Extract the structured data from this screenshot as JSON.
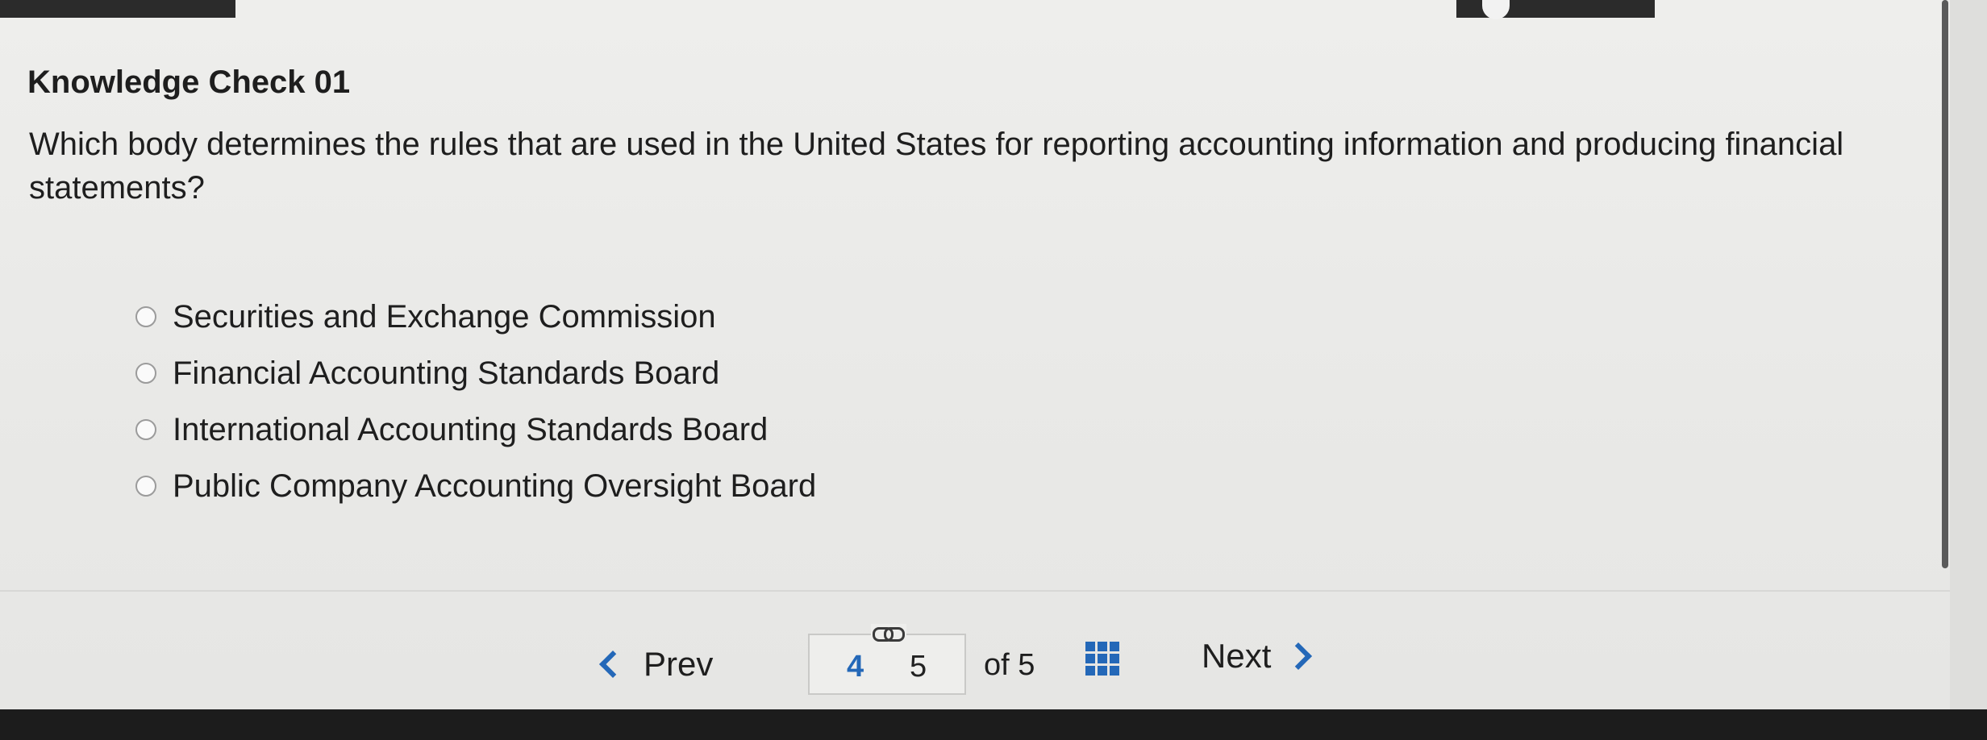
{
  "quiz": {
    "title": "Knowledge Check 01",
    "question": "Which body determines the rules that are used in the United States for reporting accounting information and producing financial statements?",
    "options": [
      "Securities and Exchange Commission",
      "Financial Accounting Standards Board",
      "International Accounting Standards Board",
      "Public Company Accounting Oversight Board"
    ]
  },
  "pagination": {
    "prev_label": "Prev",
    "next_label": "Next",
    "pages": [
      "4",
      "5"
    ],
    "current_page": "4",
    "of_text": "of 5"
  },
  "icons": {
    "prev": "chevron-left-icon",
    "next": "chevron-right-icon",
    "link": "link-icon",
    "grid": "grid-icon"
  },
  "colors": {
    "accent": "#2468b8",
    "text": "#1e1e1e",
    "background": "#ebebe9"
  }
}
